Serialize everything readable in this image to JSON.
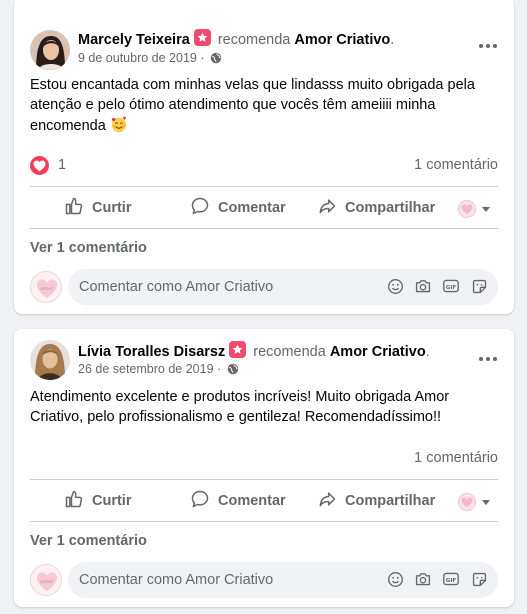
{
  "posts": [
    {
      "author": "Marcely Teixeira",
      "verb": "recomenda",
      "page": "Amor Criativo",
      "date": "9 de outubro de 2019",
      "separator": "·",
      "text": "Estou encantada com minhas velas que lindasss muito obrigada pela atenção e pelo ótimo atendimento que vocês têm ameiiii minha encomenda",
      "reaction_count": "1",
      "comment_count": "1 comentário",
      "view_comments": "Ver 1 comentário"
    },
    {
      "author": "Lívia Toralles Disarsz",
      "verb": "recomenda",
      "page": "Amor Criativo",
      "date": "26 de setembro de 2019",
      "separator": "·",
      "text": "Atendimento excelente e produtos incríveis! Muito obrigada Amor Criativo, pelo profissionalismo e gentileza! Recomendadíssimo!!",
      "comment_count": "1 comentário",
      "view_comments": "Ver 1 comentário"
    }
  ],
  "actions": {
    "like": "Curtir",
    "comment": "Comentar",
    "share": "Compartilhar"
  },
  "composer": {
    "placeholder": "Comentar como Amor Criativo"
  },
  "icons": [
    "star-badge-icon",
    "globe-icon",
    "more-icon",
    "love-reaction-icon",
    "like-icon",
    "comment-icon",
    "share-icon",
    "caret-down-icon",
    "emoji-icon",
    "camera-icon",
    "gif-icon",
    "sticker-icon"
  ],
  "colors": {
    "background": "#f0f2f5",
    "card": "#ffffff",
    "secondary_text": "#65676b",
    "love": "#f33e58",
    "badge": "#f04a6e"
  }
}
